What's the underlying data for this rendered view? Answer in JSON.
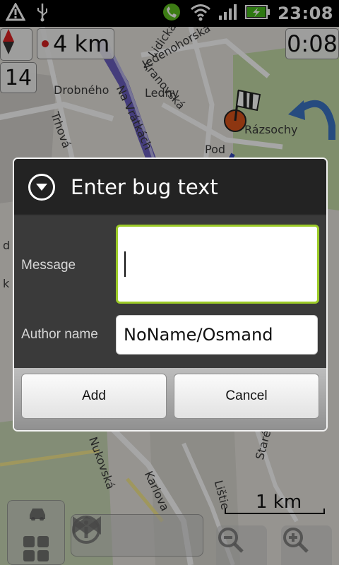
{
  "status_bar": {
    "time": "23:08",
    "icons": [
      "alert-icon",
      "usb-icon",
      "phone-speaker-icon",
      "wifi-icon",
      "signal-icon",
      "battery-charging-icon"
    ]
  },
  "map": {
    "street_labels": [
      "Drobného",
      "Trhová",
      "Na Vrátkách",
      "Ledny",
      "Vranovská",
      "Lidická",
      "Jedenohorská",
      "Rázsochy",
      "Pod",
      "Nukovská",
      "Karlova",
      "Lištie",
      "Staré",
      "d",
      "k"
    ],
    "distance": "4 km",
    "zoom_level": "14",
    "timer": "0:08",
    "scale": "1 km"
  },
  "dialog": {
    "title": "Enter bug text",
    "message_label": "Message",
    "message_value": "",
    "author_label": "Author name",
    "author_value": "NoName/Osmand",
    "add_label": "Add",
    "cancel_label": "Cancel"
  },
  "colors": {
    "input_focus": "#9ccb27",
    "dialog_bg": "#2d2d2d",
    "route": "#3347b8"
  }
}
